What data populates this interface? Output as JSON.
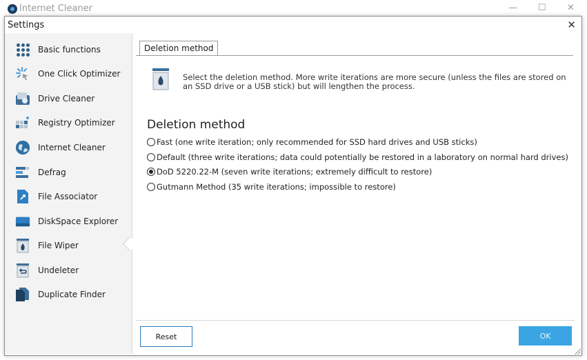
{
  "app": {
    "title": "Internet Cleaner"
  },
  "window_controls": {
    "minimize": "—",
    "maximize": "☐",
    "close": "✕"
  },
  "dialog": {
    "title": "Settings",
    "close": "✕"
  },
  "sidebar": {
    "items": [
      {
        "label": "Basic functions",
        "icon": "grid-dots-icon"
      },
      {
        "label": "One Click Optimizer",
        "icon": "sparkle-cursor-icon"
      },
      {
        "label": "Drive Cleaner",
        "icon": "drive-cleaner-icon"
      },
      {
        "label": "Registry Optimizer",
        "icon": "registry-icon"
      },
      {
        "label": "Internet Cleaner",
        "icon": "globe-icon"
      },
      {
        "label": "Defrag",
        "icon": "defrag-icon"
      },
      {
        "label": "File Associator",
        "icon": "file-associator-icon"
      },
      {
        "label": "DiskSpace Explorer",
        "icon": "disk-icon"
      },
      {
        "label": "File Wiper",
        "icon": "trash-flame-icon"
      },
      {
        "label": "Undeleter",
        "icon": "trash-restore-icon"
      },
      {
        "label": "Duplicate Finder",
        "icon": "duplicate-icon"
      }
    ],
    "selected": "File Wiper"
  },
  "tab": {
    "label": "Deletion method"
  },
  "info": {
    "text": "Select the deletion method. More write iterations are more secure (unless the files are stored on an SSD drive or a USB stick) but will lengthen the process."
  },
  "section": {
    "heading": "Deletion method",
    "options": [
      {
        "label": "Fast (one write iteration; only recommended for SSD hard drives and USB sticks)",
        "checked": false
      },
      {
        "label": "Default (three write iterations; data could potentially be restored in a laboratory on normal hard drives)",
        "checked": false
      },
      {
        "label": "DoD 5220.22-M (seven write iterations; extremely difficult to restore)",
        "checked": true
      },
      {
        "label": "Gutmann Method (35 write iterations; impossible to restore)",
        "checked": false
      }
    ]
  },
  "buttons": {
    "reset": "Reset",
    "ok": "OK"
  },
  "colors": {
    "accent": "#3ba5e3",
    "border_accent": "#2a7ab8",
    "icon_blue": "#2d5f8a"
  }
}
